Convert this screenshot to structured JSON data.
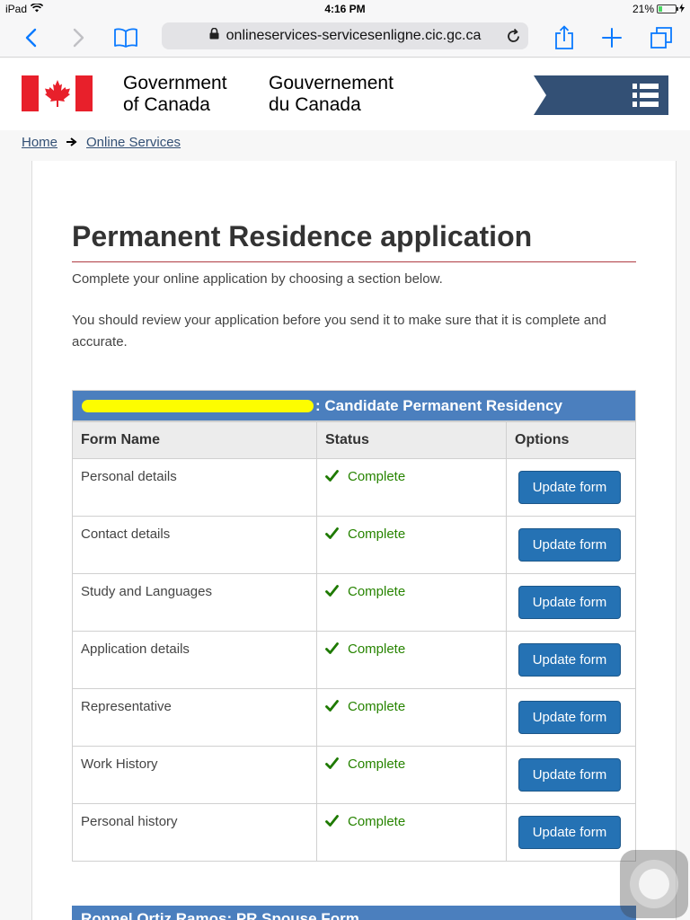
{
  "status_bar": {
    "device": "iPad",
    "time": "4:16 PM",
    "battery": "21%",
    "battery_level": 0.21
  },
  "browser": {
    "url": "onlineservices-servicesenligne.cic.gc.ca",
    "icons": [
      "back-icon",
      "forward-icon",
      "bookmarks-icon",
      "lock-icon",
      "reload-icon",
      "share-icon",
      "new-tab-icon",
      "tabs-icon"
    ]
  },
  "header": {
    "gov_en_line1": "Government",
    "gov_en_line2": "of Canada",
    "gov_fr_line1": "Gouvernement",
    "gov_fr_line2": "du Canada",
    "menu_icon": "menu-icon"
  },
  "breadcrumb": {
    "home": "Home",
    "online_services": "Online Services"
  },
  "page": {
    "title": "Permanent Residence application",
    "intro1": "Complete your online application by choosing a section below.",
    "intro2": "You should review your application before you send it to make sure that it is complete and accurate."
  },
  "application": {
    "heading": ": Candidate Permanent Residency",
    "columns": [
      "Form Name",
      "Status",
      "Options"
    ],
    "rows": [
      {
        "form": "Personal details",
        "status": "Complete",
        "option": "Update form"
      },
      {
        "form": "Contact details",
        "status": "Complete",
        "option": "Update form"
      },
      {
        "form": "Study and Languages",
        "status": "Complete",
        "option": "Update form"
      },
      {
        "form": "Application details",
        "status": "Complete",
        "option": "Update form"
      },
      {
        "form": "Representative",
        "status": "Complete",
        "option": "Update form"
      },
      {
        "form": "Work History",
        "status": "Complete",
        "option": "Update form"
      },
      {
        "form": "Personal history",
        "status": "Complete",
        "option": "Update form"
      }
    ]
  },
  "next_application": {
    "heading": "Ronnel Ortiz Ramos: PR Spouse Form"
  },
  "colors": {
    "accent_blue": "#2572b4",
    "header_blue": "#4b7fbe",
    "status_green": "#278400",
    "flag_red": "#e8202b",
    "rule_red": "#af3c43"
  }
}
